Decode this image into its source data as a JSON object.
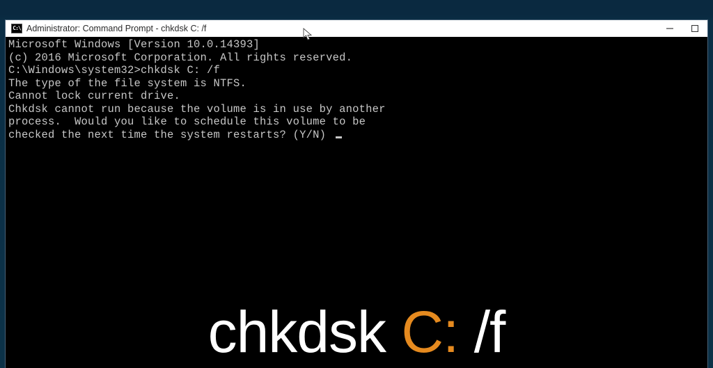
{
  "window": {
    "icon_label": "C:\\",
    "title": "Administrator: Command Prompt - chkdsk  C: /f"
  },
  "terminal": {
    "lines": [
      "Microsoft Windows [Version 10.0.14393]",
      "(c) 2016 Microsoft Corporation. All rights reserved.",
      "",
      "C:\\Windows\\system32>chkdsk C: /f",
      "The type of the file system is NTFS.",
      "Cannot lock current drive.",
      "",
      "Chkdsk cannot run because the volume is in use by another",
      "process.  Would you like to schedule this volume to be",
      "checked the next time the system restarts? (Y/N) "
    ]
  },
  "caption": {
    "part1": "chkdsk ",
    "part2": "C:",
    "part3": " /f"
  }
}
